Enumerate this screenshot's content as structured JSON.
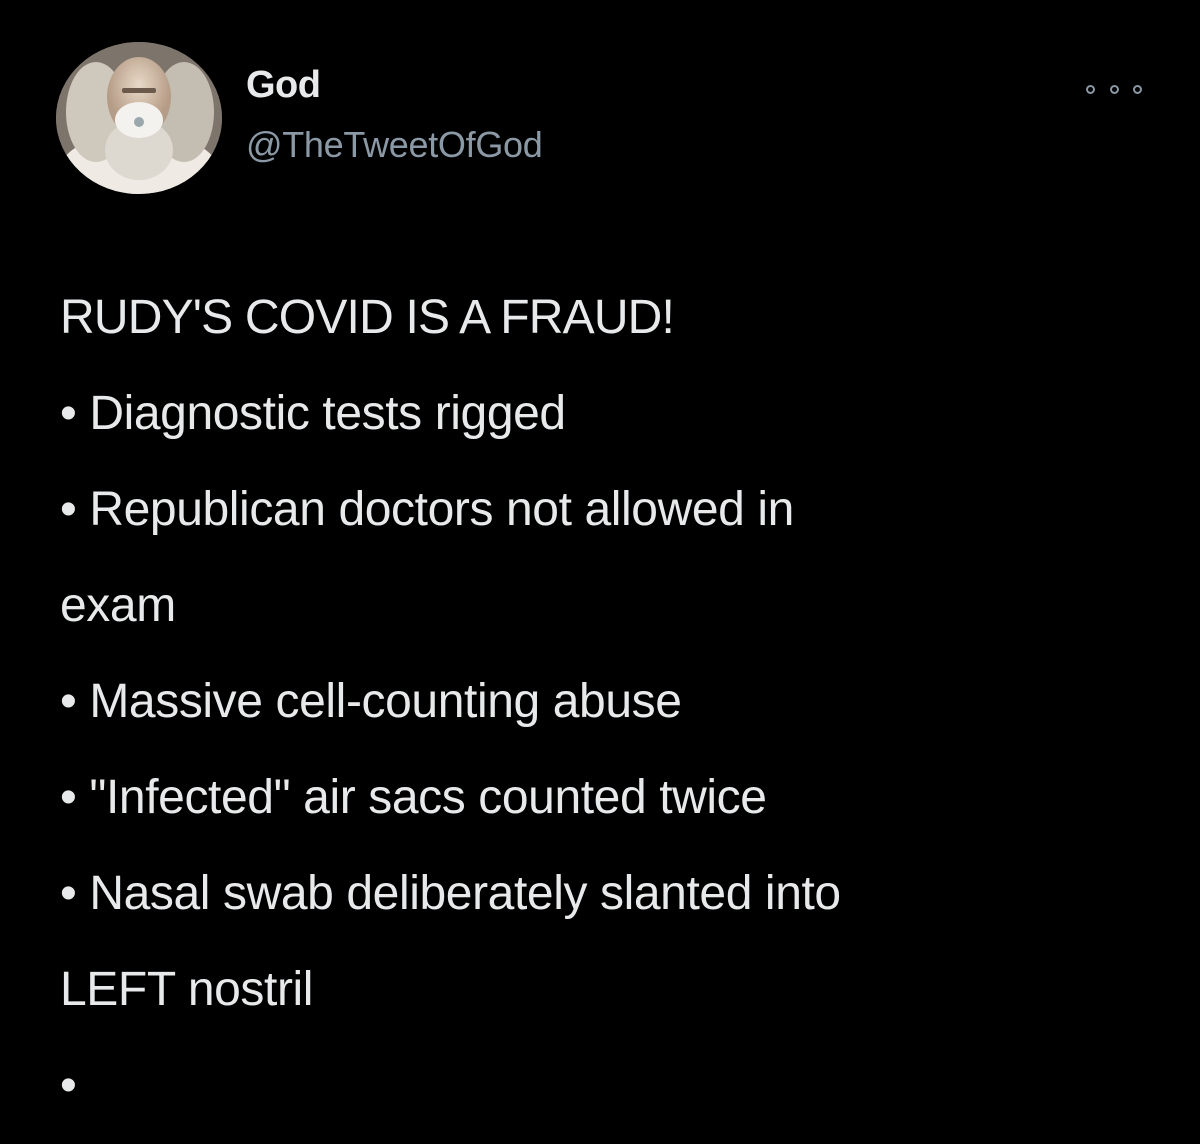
{
  "tweet": {
    "author": {
      "display_name": "God",
      "handle": "@TheTweetOfGod",
      "avatar_icon": "avatar-photo-bearded-man-mask"
    },
    "menu_icon": "more-horizontal-icon",
    "lines": [
      "RUDY'S COVID IS A FRAUD!",
      "• Diagnostic tests rigged",
      "• Republican doctors not allowed in",
      "exam",
      "• Massive cell-counting abuse",
      "• \"Infected\" air sacs counted twice",
      "• Nasal swab deliberately slanted into",
      "LEFT nostril",
      "•"
    ]
  },
  "colors": {
    "background": "#000000",
    "text_primary": "#e7e9ea",
    "text_secondary": "#8b98a5"
  }
}
